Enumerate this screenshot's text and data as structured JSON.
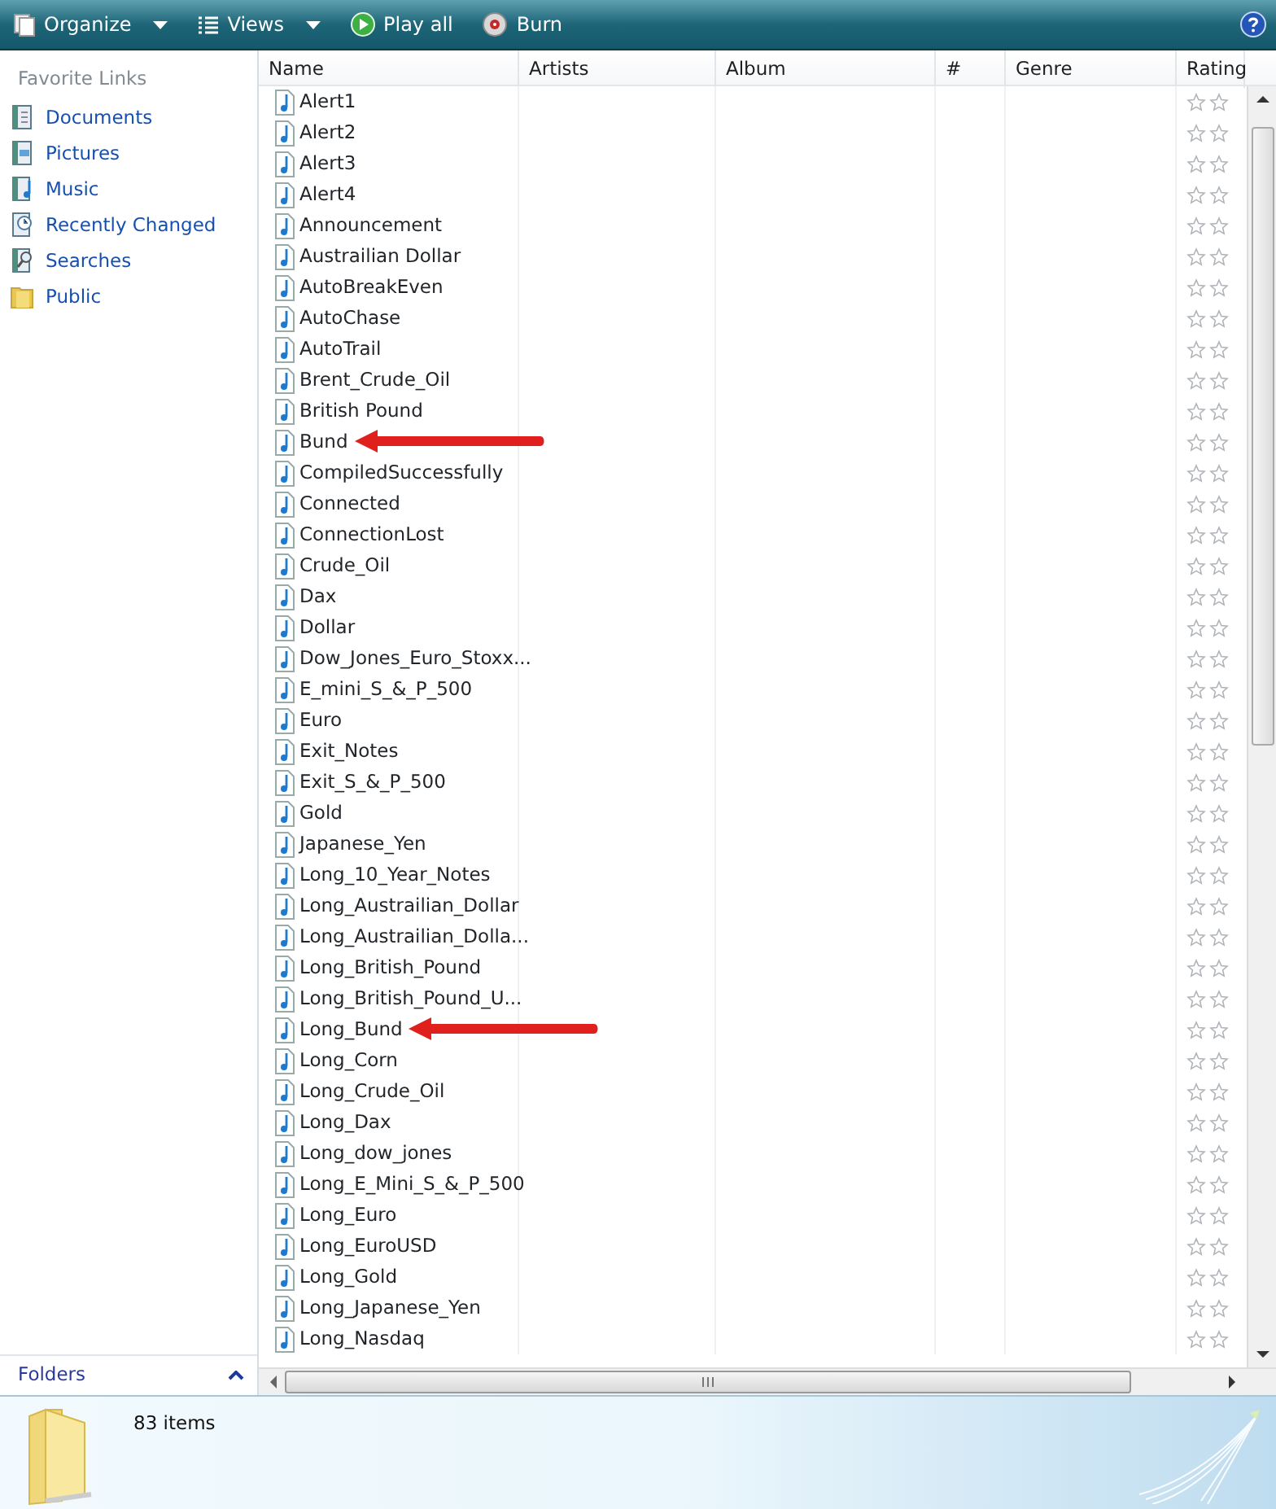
{
  "toolbar": {
    "buttons": [
      {
        "label": "Organize",
        "kind": "organize",
        "dropdown": true
      },
      {
        "label": "Views",
        "kind": "views",
        "dropdown": true
      },
      {
        "label": "Play all",
        "kind": "play",
        "dropdown": false
      },
      {
        "label": "Burn",
        "kind": "burn",
        "dropdown": false
      }
    ]
  },
  "sidebar": {
    "heading": "Favorite Links",
    "items": [
      {
        "label": "Documents",
        "kind": "documents"
      },
      {
        "label": "Pictures",
        "kind": "pictures"
      },
      {
        "label": "Music",
        "kind": "music"
      },
      {
        "label": "Recently Changed",
        "kind": "recent"
      },
      {
        "label": "Searches",
        "kind": "searches"
      },
      {
        "label": "Public",
        "kind": "public"
      }
    ],
    "folders_label": "Folders"
  },
  "table": {
    "columns": [
      "Name",
      "Artists",
      "Album",
      "#",
      "Genre",
      "Rating"
    ],
    "rows": [
      {
        "name": "Alert1",
        "arrow": false
      },
      {
        "name": "Alert2",
        "arrow": false
      },
      {
        "name": "Alert3",
        "arrow": false
      },
      {
        "name": "Alert4",
        "arrow": false
      },
      {
        "name": "Announcement",
        "arrow": false
      },
      {
        "name": "Austrailian Dollar",
        "arrow": false
      },
      {
        "name": "AutoBreakEven",
        "arrow": false
      },
      {
        "name": "AutoChase",
        "arrow": false
      },
      {
        "name": "AutoTrail",
        "arrow": false
      },
      {
        "name": "Brent_Crude_Oil",
        "arrow": false
      },
      {
        "name": "British Pound",
        "arrow": false
      },
      {
        "name": "Bund",
        "arrow": true
      },
      {
        "name": "CompiledSuccessfully",
        "arrow": false
      },
      {
        "name": "Connected",
        "arrow": false
      },
      {
        "name": "ConnectionLost",
        "arrow": false
      },
      {
        "name": "Crude_Oil",
        "arrow": false
      },
      {
        "name": "Dax",
        "arrow": false
      },
      {
        "name": "Dollar",
        "arrow": false
      },
      {
        "name": "Dow_Jones_Euro_Stoxx...",
        "arrow": false
      },
      {
        "name": "E_mini_S_&_P_500",
        "arrow": false
      },
      {
        "name": "Euro",
        "arrow": false
      },
      {
        "name": "Exit_Notes",
        "arrow": false
      },
      {
        "name": "Exit_S_&_P_500",
        "arrow": false
      },
      {
        "name": "Gold",
        "arrow": false
      },
      {
        "name": "Japanese_Yen",
        "arrow": false
      },
      {
        "name": "Long_10_Year_Notes",
        "arrow": false
      },
      {
        "name": "Long_Austrailian_Dollar",
        "arrow": false
      },
      {
        "name": "Long_Austrailian_Dolla...",
        "arrow": false
      },
      {
        "name": "Long_British_Pound",
        "arrow": false
      },
      {
        "name": "Long_British_Pound_U...",
        "arrow": false
      },
      {
        "name": "Long_Bund",
        "arrow": true
      },
      {
        "name": "Long_Corn",
        "arrow": false
      },
      {
        "name": "Long_Crude_Oil",
        "arrow": false
      },
      {
        "name": "Long_Dax",
        "arrow": false
      },
      {
        "name": "Long_dow_jones",
        "arrow": false
      },
      {
        "name": "Long_E_Mini_S_&_P_500",
        "arrow": false
      },
      {
        "name": "Long_Euro",
        "arrow": false
      },
      {
        "name": "Long_EuroUSD",
        "arrow": false
      },
      {
        "name": "Long_Gold",
        "arrow": false
      },
      {
        "name": "Long_Japanese_Yen",
        "arrow": false
      },
      {
        "name": "Long_Nasdaq",
        "arrow": false
      }
    ]
  },
  "status_bar": {
    "item_count": "83 items"
  }
}
